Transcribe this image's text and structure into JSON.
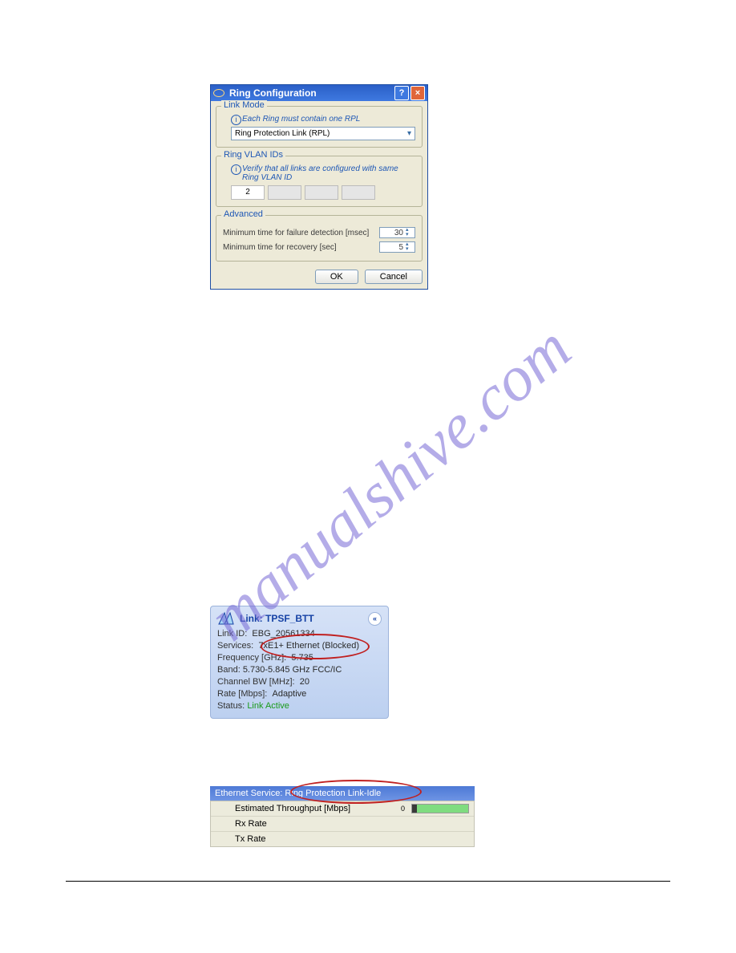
{
  "dialog": {
    "title": "Ring Configuration",
    "linkmode": {
      "legend": "Link Mode",
      "hint": "Each Ring must contain one RPL",
      "combo": "Ring Protection Link (RPL)"
    },
    "vlan": {
      "legend": "Ring VLAN IDs",
      "hint": "Verify that all links are configured with same Ring VLAN ID",
      "v1": "2"
    },
    "adv": {
      "legend": "Advanced",
      "r1": "Minimum time for failure detection [msec]",
      "v1": "30",
      "r2": "Minimum time for recovery [sec]",
      "v2": "5"
    },
    "ok": "OK",
    "cancel": "Cancel"
  },
  "card": {
    "head": "Link: TPSF_BTT",
    "linkid_l": "Link ID:",
    "linkid": "EBG_20561334",
    "svc_l": "Services:",
    "svc": "7xE1+ Ethernet (Blocked)",
    "freq_l": "Frequency [GHz]:",
    "freq": "5.735",
    "band_l": "Band:",
    "band": "5.730-5.845 GHz FCC/IC",
    "bw_l": "Channel BW [MHz]:",
    "bw": "20",
    "rate_l": "Rate [Mbps]:",
    "rate": "Adaptive",
    "stat_l": "Status:",
    "stat": "Link Active"
  },
  "svc": {
    "head": "Ethernet Service: Ring Protection Link-Idle",
    "r1": "Estimated Throughput [Mbps]",
    "r2": "Rx Rate",
    "r3": "Tx Rate",
    "b": "0"
  },
  "watermark": "manualshive.com"
}
